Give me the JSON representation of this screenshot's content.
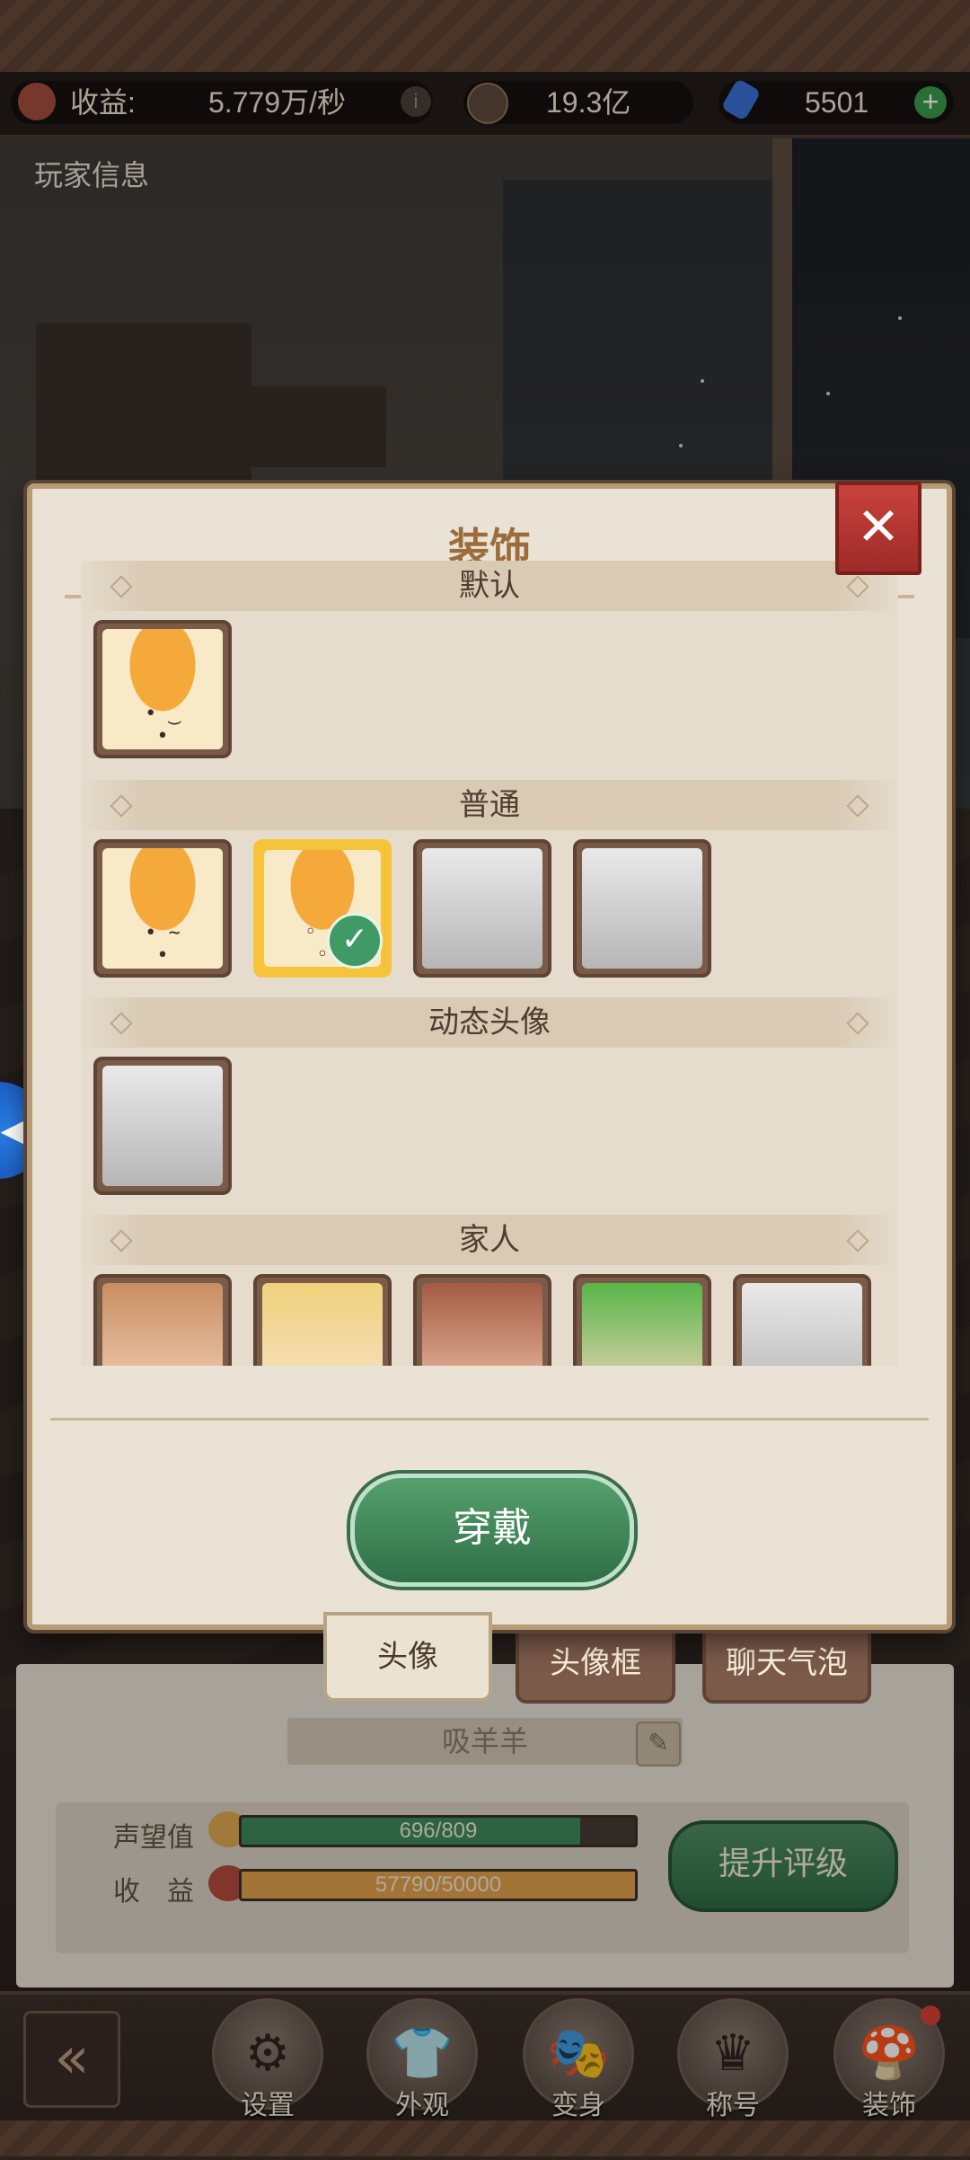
{
  "top_bar": {
    "income_label": "收益:",
    "income_value": "5.779万/秒",
    "coins": "19.3亿",
    "gems": "5501"
  },
  "screen_title": "玩家信息",
  "modal": {
    "title": "装饰",
    "close_icon": "close-x",
    "sections": [
      {
        "title": "默认"
      },
      {
        "title": "普通"
      },
      {
        "title": "动态头像"
      },
      {
        "title": "家人"
      }
    ],
    "wear_button": "穿戴"
  },
  "tabs": {
    "avatar": "头像",
    "avatar_frame": "头像框",
    "chat_bubble": "聊天气泡"
  },
  "profile": {
    "name": "吸羊羊",
    "reputation_label": "声望值",
    "reputation_value": "696/809",
    "reputation_fraction": 0.86,
    "income_label": "收　益",
    "income_value": "57790/50000",
    "income_fraction": 1.0,
    "upgrade_button": "提升评级"
  },
  "bottom_nav": [
    {
      "label": "设置",
      "icon": "gear-icon"
    },
    {
      "label": "外观",
      "icon": "outfit-icon"
    },
    {
      "label": "变身",
      "icon": "mask-icon"
    },
    {
      "label": "称号",
      "icon": "crown-icon"
    },
    {
      "label": "装饰",
      "icon": "mushroom-icon"
    }
  ],
  "colors": {
    "accent_green": "#3f8a5a",
    "title_brown": "#9c6d3c",
    "close_red": "#c9423c",
    "selected_gold": "#f6c43b"
  }
}
